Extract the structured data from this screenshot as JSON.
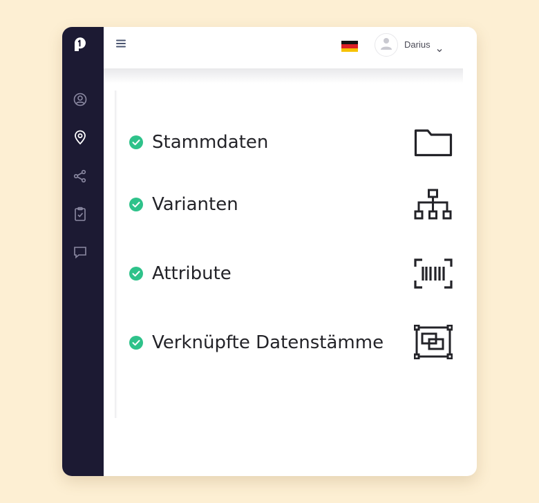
{
  "header": {
    "language_flag": "german-flag",
    "user": {
      "name": "Darius"
    }
  },
  "sidebar": {
    "items": [
      {
        "icon": "user-circle-icon"
      },
      {
        "icon": "map-pin-icon",
        "active": true
      },
      {
        "icon": "share-icon"
      },
      {
        "icon": "clipboard-check-icon"
      },
      {
        "icon": "message-icon"
      }
    ]
  },
  "features": [
    {
      "label": "Stammdaten",
      "icon": "folder-icon"
    },
    {
      "label": "Varianten",
      "icon": "hierarchy-icon"
    },
    {
      "label": "Attribute",
      "icon": "barcode-icon"
    },
    {
      "label": "Verknüpfte Datenstämme",
      "icon": "linked-frames-icon"
    }
  ],
  "colors": {
    "page_background": "#fdefd3",
    "sidebar": "#1c1a33",
    "check_green": "#2ec28a",
    "text": "#232328"
  }
}
